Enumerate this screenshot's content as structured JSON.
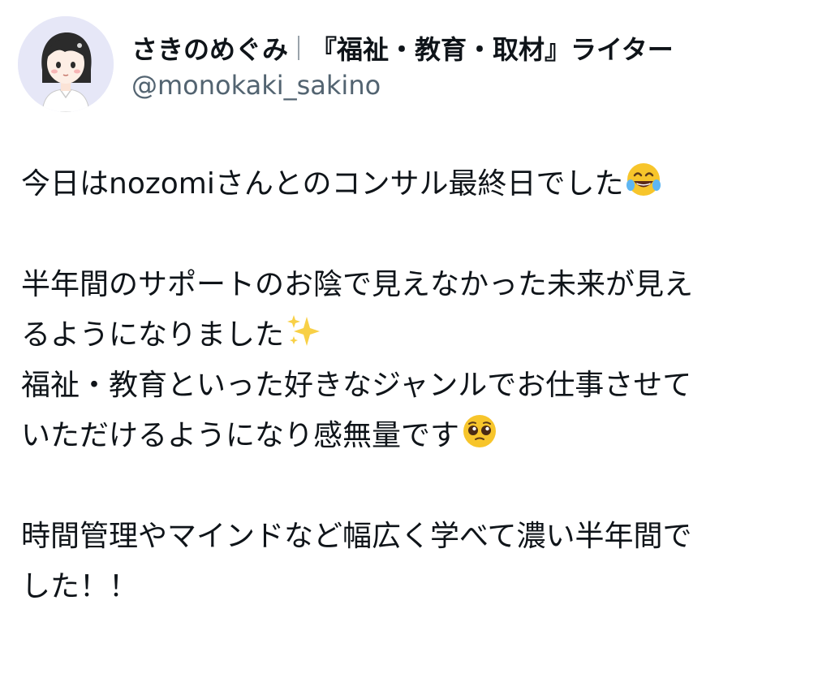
{
  "author": {
    "display_name": "さきのめぐみ",
    "name_suffix": "『福祉・教育・取材』ライター",
    "handle": "@monokaki_sakino",
    "avatar_icon": "illustrated-girl-avatar"
  },
  "tweet": {
    "line1": "今日はnozomiさんとのコンサル最終日でした",
    "line1_emoji": "face-with-tears-of-joy-icon",
    "line2": "半年間のサポートのお陰で見えなかった未来が見え",
    "line3": "るようになりました",
    "line3_emoji": "sparkles-icon",
    "line4": "福祉・教育といった好きなジャンルでお仕事させて",
    "line5": "いただけるようになり感無量です",
    "line5_emoji": "pleading-face-icon",
    "line6": "時間管理やマインドなど幅広く学べて濃い半年間で",
    "line7": "した！！"
  },
  "colors": {
    "text": "#0f1419",
    "handle": "#536471",
    "avatar_bg": "#e6e7f7"
  }
}
